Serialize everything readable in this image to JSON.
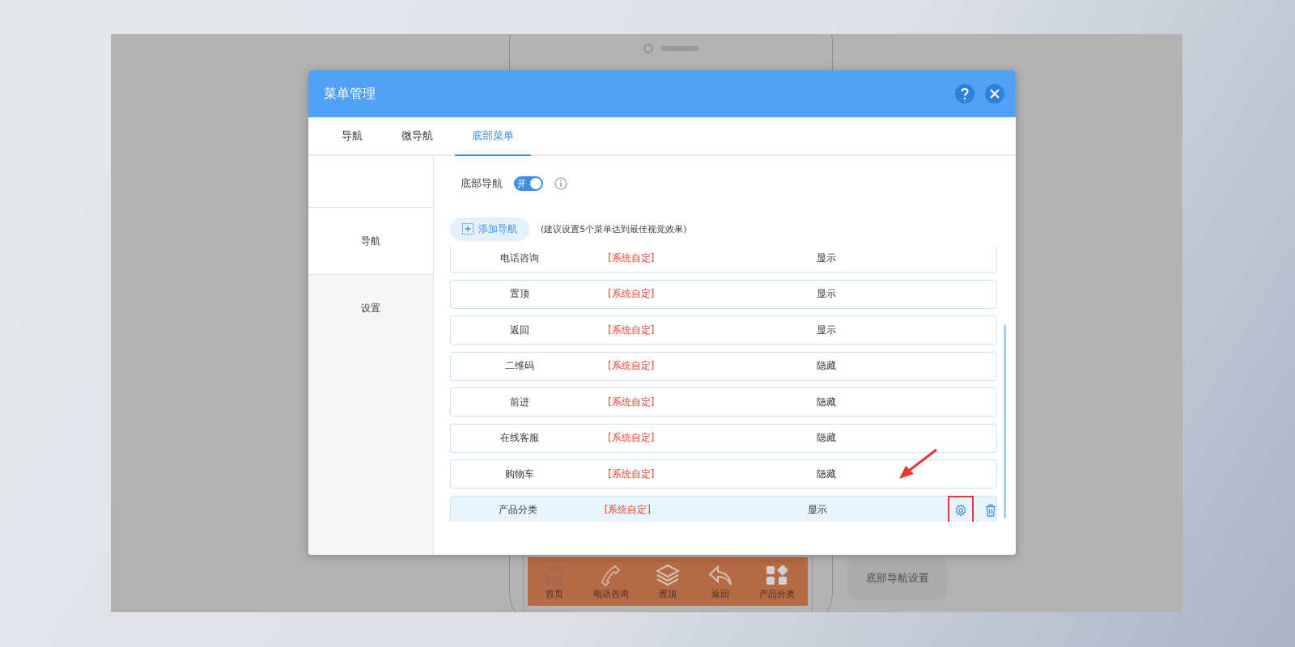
{
  "dialog": {
    "title": "菜单管理",
    "tabs": [
      {
        "label": "导航",
        "selected": false
      },
      {
        "label": "微导航",
        "selected": false
      },
      {
        "label": "底部菜单",
        "selected": true
      }
    ],
    "sidebar": [
      {
        "label": "导航",
        "selected": true
      },
      {
        "label": "设置",
        "selected": false
      }
    ],
    "toggle": {
      "label": "底部导航",
      "on": true,
      "text": "开"
    },
    "add_button": "添加导航",
    "hint": "(建议设置5个菜单达到最佳视觉效果)",
    "rows": [
      {
        "name": "电话咨询",
        "type": "[系统自定]",
        "status": "显示",
        "selected": false
      },
      {
        "name": "置顶",
        "type": "[系统自定]",
        "status": "显示",
        "selected": false
      },
      {
        "name": "返回",
        "type": "[系统自定]",
        "status": "显示",
        "selected": false
      },
      {
        "name": "二维码",
        "type": "[系统自定]",
        "status": "隐藏",
        "selected": false
      },
      {
        "name": "前进",
        "type": "[系统自定]",
        "status": "隐藏",
        "selected": false
      },
      {
        "name": "在线客服",
        "type": "[系统自定]",
        "status": "隐藏",
        "selected": false
      },
      {
        "name": "购物车",
        "type": "[系统自定]",
        "status": "隐藏",
        "selected": false
      },
      {
        "name": "产品分类",
        "type": "[系统自定]",
        "status": "显示",
        "selected": true
      }
    ]
  },
  "phone": {
    "nav": [
      {
        "label": "首页",
        "kind": "home"
      },
      {
        "label": "电话咨询",
        "kind": "phone"
      },
      {
        "label": "置顶",
        "kind": "layers"
      },
      {
        "label": "返回",
        "kind": "back"
      },
      {
        "label": "产品分类",
        "kind": "grid"
      }
    ],
    "settings_button": "底部导航设置"
  }
}
